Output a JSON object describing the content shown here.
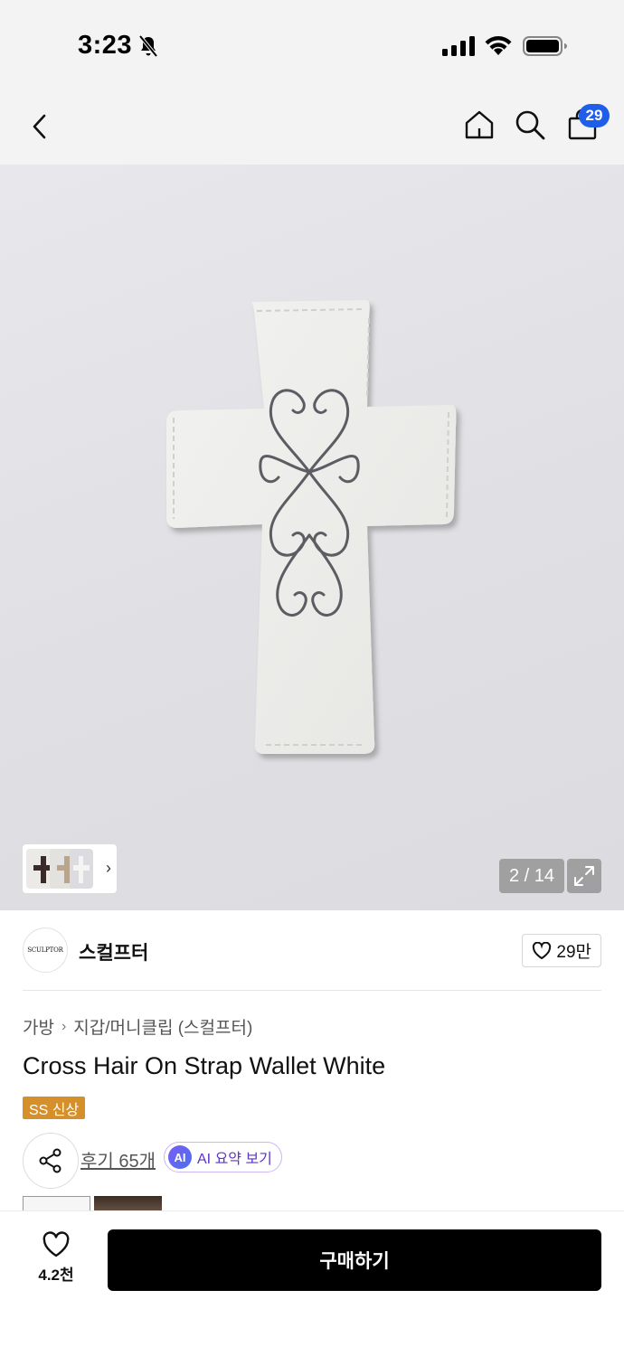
{
  "status_bar": {
    "time": "3:23"
  },
  "nav": {
    "cart_count": "29"
  },
  "gallery": {
    "counter": "2 / 14",
    "expand_icon": "expand-arrows-icon"
  },
  "brand": {
    "logo_text": "SCULPTOR",
    "name": "스컬프터",
    "like_count": "29만"
  },
  "breadcrumb": {
    "category": "가방",
    "subcategory": "지갑/머니클립 (스컬프터)"
  },
  "product": {
    "title": "Cross Hair On Strap Wallet White",
    "season_badge": "SS 신상",
    "review_link": "후기 65개",
    "ai_badge": "AI",
    "ai_label": "AI 요약 보기"
  },
  "bottom_bar": {
    "wish_count": "4.2천",
    "buy_label": "구매하기"
  },
  "colors": {
    "accent_blue": "#1f5ee8",
    "season_badge": "#d5902b",
    "ai_purple": "#5b33c9",
    "buy_button": "#000000"
  }
}
